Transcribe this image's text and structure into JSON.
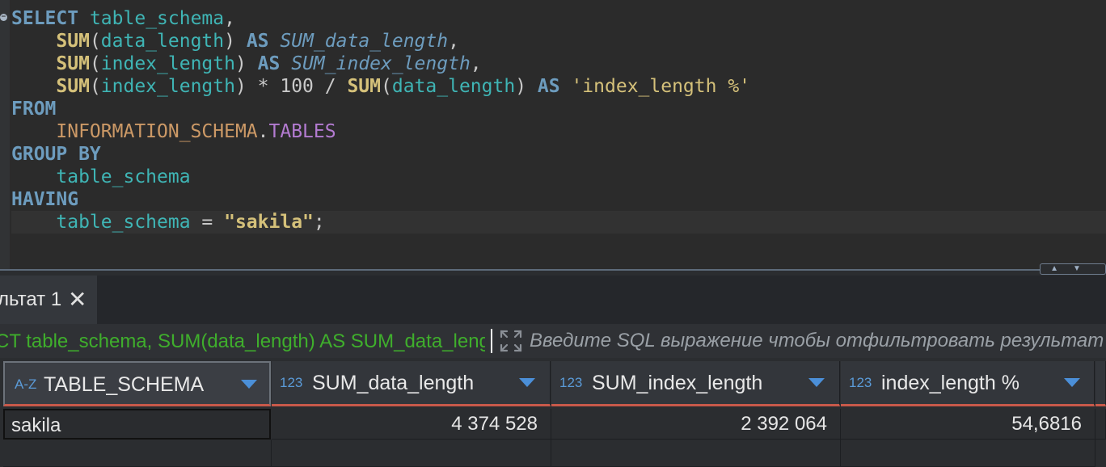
{
  "editor": {
    "lines": [
      [
        "SELECT",
        " ",
        "table_schema",
        ","
      ],
      [
        "    ",
        "SUM",
        "(",
        "data_length",
        ") ",
        "AS",
        " ",
        "SUM_data_length",
        ","
      ],
      [
        "    ",
        "SUM",
        "(",
        "index_length",
        ") ",
        "AS",
        " ",
        "SUM_index_length",
        ","
      ],
      [
        "    ",
        "SUM",
        "(",
        "index_length",
        ") * 100 / ",
        "SUM",
        "(",
        "data_length",
        ") ",
        "AS",
        " ",
        "'index_length %'"
      ],
      [
        "FROM"
      ],
      [
        "    ",
        "INFORMATION_SCHEMA",
        ".",
        "TABLES"
      ],
      [
        "GROUP BY"
      ],
      [
        "    ",
        "table_schema"
      ],
      [
        "HAVING"
      ],
      [
        "    ",
        "table_schema",
        " = ",
        "\"sakila\"",
        ";"
      ]
    ]
  },
  "results": {
    "tab_label": "льтат 1",
    "close_glyph": "✕",
    "query_text": "CT table_schema, SUM(data_length) AS SUM_data_length, SUM(index_length) AS SUM_index_length",
    "filter_placeholder": "Введите SQL выражение чтобы отфильтровать результат",
    "columns": [
      {
        "type": "A-Z",
        "name": "TABLE_SCHEMA"
      },
      {
        "type": "123",
        "name": "SUM_data_length"
      },
      {
        "type": "123",
        "name": "SUM_index_length"
      },
      {
        "type": "123",
        "name": "index_length %"
      }
    ],
    "rows": [
      [
        "sakila",
        "4 374 528",
        "2 392 064",
        "54,6816"
      ]
    ]
  },
  "icons": {
    "fold": "fold-minus-icon",
    "close": "close-icon",
    "expand": "expand-icon",
    "sort": "chevron-down-icon"
  },
  "colors": {
    "keyword": "#6d9cbe",
    "function": "#d5c17a",
    "identifier": "#3fb5b5",
    "alias": "#9876aa",
    "header_underline": "#c8594a",
    "query_text": "#3fae2c"
  }
}
